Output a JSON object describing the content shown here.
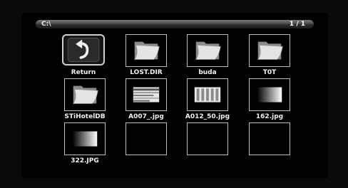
{
  "path_bar": {
    "path": "C:\\",
    "page_indicator": "1 / 1"
  },
  "items": [
    {
      "label": "Return",
      "icon": "return-arrow-icon",
      "selected": true
    },
    {
      "label": "LOST.DIR",
      "icon": "folder-icon"
    },
    {
      "label": "buda",
      "icon": "folder-icon"
    },
    {
      "label": "T0T",
      "icon": "folder-icon"
    },
    {
      "label": "STiHotelDB",
      "icon": "folder-icon"
    },
    {
      "label": "A007_.jpg",
      "icon": "image-thumbnail-icon"
    },
    {
      "label": "A012_50.jpg",
      "icon": "image-thumbnail-icon"
    },
    {
      "label": "162.jpg",
      "icon": "image-thumbnail-icon"
    },
    {
      "label": "322.JPG",
      "icon": "image-thumbnail-icon"
    },
    {
      "label": "",
      "icon": ""
    },
    {
      "label": "",
      "icon": ""
    },
    {
      "label": "",
      "icon": ""
    }
  ]
}
